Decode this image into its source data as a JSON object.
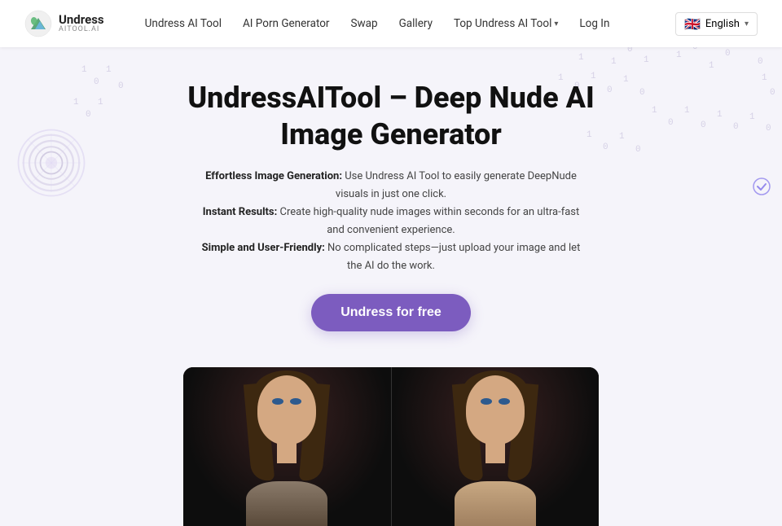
{
  "logo": {
    "main": "Undress",
    "sub": "AITOOL.AI"
  },
  "nav": {
    "links": [
      {
        "label": "Undress AI Tool",
        "id": "undress-ai-tool",
        "dropdown": false
      },
      {
        "label": "AI Porn Generator",
        "id": "ai-porn-generator",
        "dropdown": false
      },
      {
        "label": "Swap",
        "id": "swap",
        "dropdown": false
      },
      {
        "label": "Gallery",
        "id": "gallery",
        "dropdown": false
      },
      {
        "label": "Top Undress AI Tool",
        "id": "top-undress-ai-tool",
        "dropdown": true
      },
      {
        "label": "Log In",
        "id": "log-in",
        "dropdown": false
      }
    ],
    "language": {
      "flag": "🇬🇧",
      "label": "English"
    }
  },
  "hero": {
    "title": "UndressAITool – Deep Nude AI Image Generator",
    "description_parts": [
      {
        "bold": "Effortless Image Generation:",
        "text": " Use Undress AI Tool to easily generate DeepNude visuals in just one click."
      },
      {
        "bold": "Instant Results:",
        "text": " Create high-quality nude images within seconds for an ultra-fast and convenient experience."
      },
      {
        "bold": "Simple and User-Friendly:",
        "text": " No complicated steps—just upload your image and let the AI do the work."
      }
    ],
    "cta_button": "Undress for free"
  },
  "colors": {
    "primary": "#7c5cbf",
    "bg": "#f5f4fa",
    "nav_bg": "#ffffff"
  }
}
